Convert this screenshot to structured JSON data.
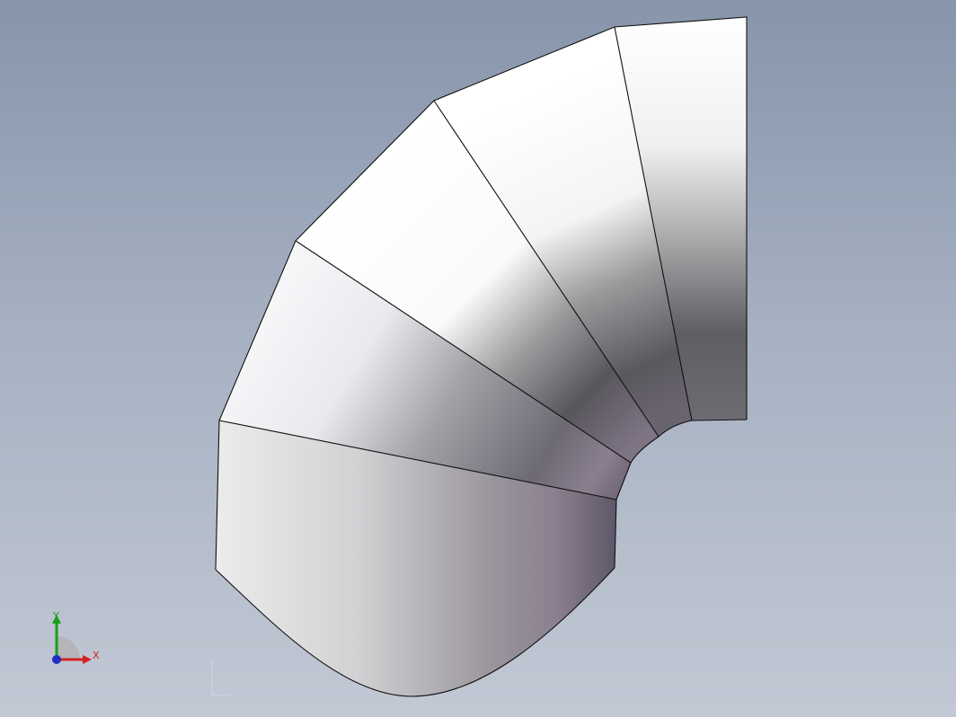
{
  "viewport": {
    "background_top": "#8795ab",
    "background_bottom": "#c2c8d4"
  },
  "model": {
    "part": "mitered-duct-elbow",
    "segments": 5,
    "edge_color": "#101010"
  },
  "triad": {
    "x_label": "X",
    "y_label": "Y",
    "x_color": "#d62020",
    "y_color": "#18a018",
    "z_color": "#2030c0"
  }
}
